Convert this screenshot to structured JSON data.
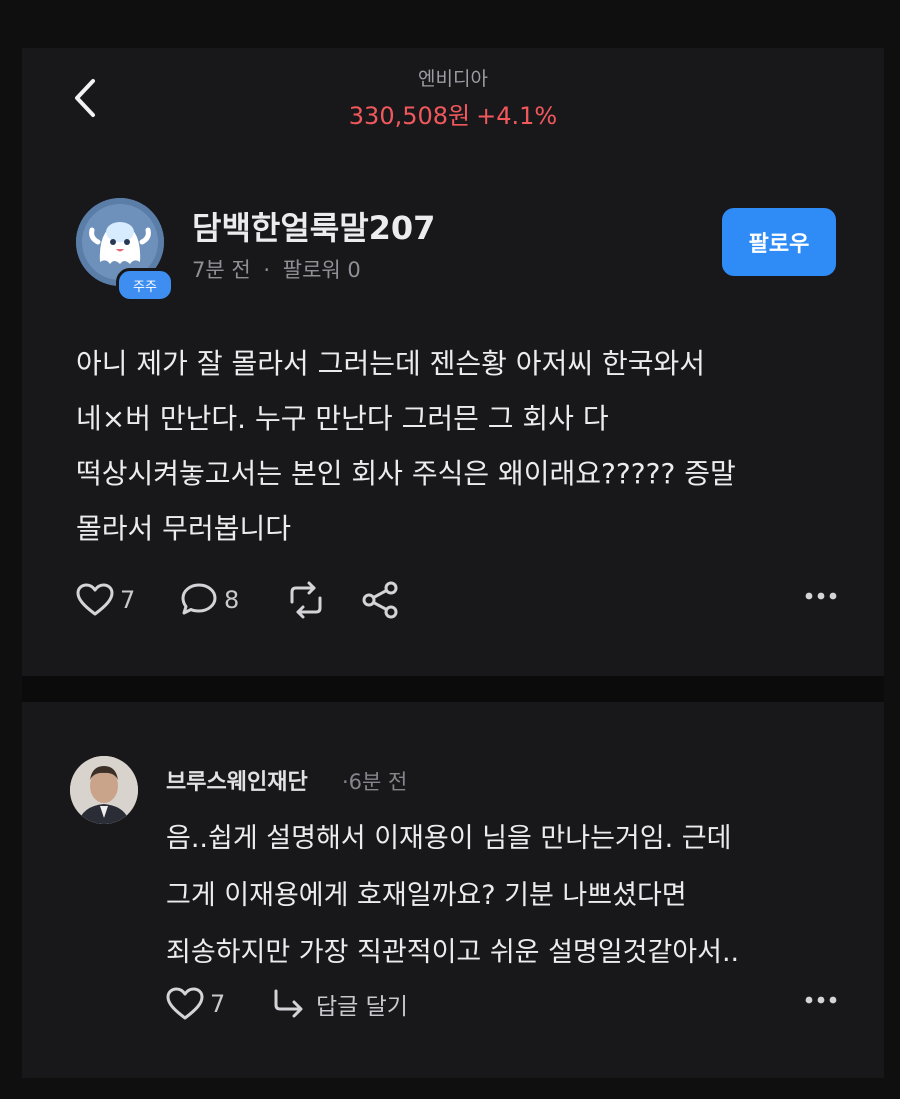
{
  "header": {
    "stock_name": "엔비디아",
    "price": "330,508원",
    "change": "+4.1%",
    "back_icon": "chevron-left-icon"
  },
  "post": {
    "author": "담백한얼룩말207",
    "badge": "주주",
    "time": "7분 전",
    "separator": "·",
    "followers": "팔로워 0",
    "follow_label": "팔로우",
    "body_lines": [
      "아니 제가 잘 몰라서 그러는데 젠슨황 아저씨 한국와서",
      "네×버 만난다. 누구 만난다 그러믄 그 회사 다",
      "떡상시켜놓고서는 본인 회사 주식은 왜이래요????? 증말",
      "몰라서 무러봅니다"
    ],
    "likes": "7",
    "comments": "8"
  },
  "comment": {
    "author": "브루스웨인재단",
    "time": "·6분 전",
    "body_lines": [
      "음..쉽게 설명해서 이재용이 님을 만나는거임. 근데",
      "그게 이재용에게 호재일까요? 기분 나쁘셨다면",
      "죄송하지만 가장 직관적이고 쉬운 설명일것같아서.."
    ],
    "likes": "7",
    "reply_label": "답글 달기"
  },
  "colors": {
    "background": "#18181b",
    "price_red": "#f0585c",
    "follow_blue": "#2f8cf6"
  }
}
